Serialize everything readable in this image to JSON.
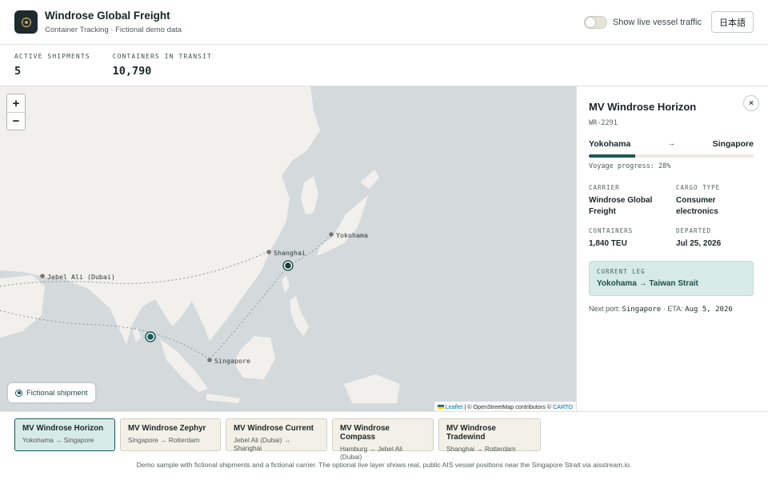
{
  "header": {
    "title": "Windrose Global Freight",
    "subtitle": "Container Tracking · Fictional demo data",
    "toggle_label": "Show live vessel traffic",
    "toggle_on": false,
    "language_button": "日本語"
  },
  "stats": [
    {
      "label": "ACTIVE SHIPMENTS",
      "value": "5"
    },
    {
      "label": "CONTAINERS IN TRANSIT",
      "value": "10,790"
    }
  ],
  "map": {
    "ports": [
      "Yokohama",
      "Shanghai",
      "Jebel Ali (Dubai)",
      "Singapore"
    ],
    "zoom_in": "+",
    "zoom_out": "−",
    "legend": "Fictional shipment",
    "attribution": {
      "leaflet": "Leaflet",
      "osm": "| © OpenStreetMap contributors ©",
      "carto": "CARTO"
    },
    "colors": {
      "water": "#d4dadc",
      "land": "#f1f0ec",
      "marker": "#1d5856"
    }
  },
  "details": {
    "vessel_name": "MV Windrose Horizon",
    "vessel_id": "WR-2291",
    "origin": "Yokohama",
    "arrow": "→",
    "destination": "Singapore",
    "progress": 0.28,
    "progress_text": "Voyage progress: 28%",
    "fields": [
      {
        "label": "CARRIER",
        "value": "Windrose Global Freight"
      },
      {
        "label": "CARGO TYPE",
        "value": "Consumer electronics"
      },
      {
        "label": "CONTAINERS",
        "value": "1,840 TEU"
      },
      {
        "label": "DEPARTED",
        "value": "Jul 25, 2026"
      }
    ],
    "current_leg_label": "CURRENT LEG",
    "current_leg": "Yokohama → Taiwan Strait",
    "next_port_prefix": "Next port:",
    "next_port": "Singapore",
    "eta_prefix": "· ETA:",
    "eta": "Aug 5, 2026",
    "close": "×"
  },
  "shipments": [
    {
      "name": "MV Windrose Horizon",
      "route": "Yokohama → Singapore",
      "active": true
    },
    {
      "name": "MV Windrose Zephyr",
      "route": "Singapore → Rotterdam",
      "active": false
    },
    {
      "name": "MV Windrose Current",
      "route": "Jebel Ali (Dubai) → Shanghai",
      "active": false
    },
    {
      "name": "MV Windrose Compass",
      "route": "Hamburg → Jebel Ali (Dubai)",
      "active": false
    },
    {
      "name": "MV Windrose Tradewind",
      "route": "Shanghai → Rotterdam",
      "active": false
    }
  ],
  "footer": "Demo sample with fictional shipments and a fictional carrier. The optional live layer shows real, public AIS vessel positions near the Singapore Strait via aisstream.io."
}
